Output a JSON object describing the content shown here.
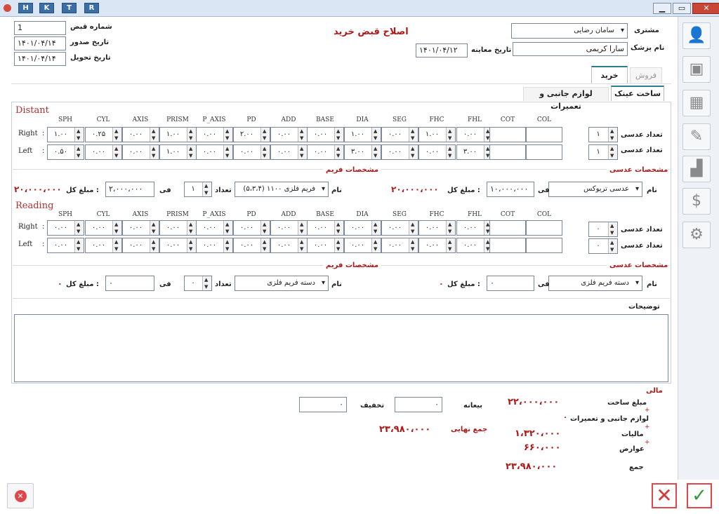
{
  "titlebar": {
    "buttons": [
      "H",
      "K",
      "T",
      "R"
    ]
  },
  "form": {
    "title": "اصلاح قبض خرید"
  },
  "header": {
    "receipt_no_label": "شماره قبض",
    "receipt_no": "1",
    "issue_date_label": "تاریخ صدور",
    "issue_date": "۱۴۰۱/۰۴/۱۴",
    "delivery_date_label": "تاریخ تحویل",
    "delivery_date": "۱۴۰۱/۰۴/۱۴",
    "customer_label": "مشتری",
    "customer": "سامان رضایی",
    "doctor_label": "نام پزشک",
    "doctor": "سارا کریمی",
    "exam_date_label": "تاریخ معاینه",
    "exam_date": "۱۴۰۱/۰۴/۱۲"
  },
  "tabs": {
    "top": [
      "فروش",
      "خرید"
    ],
    "sub": [
      "ساخت عینک",
      "لوازم جانبی و تعمیرات"
    ]
  },
  "columns": [
    "SPH",
    "CYL",
    "AXIS",
    "PRISM",
    "P_AXIS",
    "PD",
    "ADD",
    "BASE",
    "DIA",
    "SEG",
    "FHC",
    "FHL",
    "COT",
    "COL"
  ],
  "distant": {
    "title": "Distant",
    "right_label": "Right",
    "left_label": "Left",
    "right": [
      "۱.۰۰",
      "۰.۲۵",
      "۰.۰۰",
      "۱.۰۰",
      "۰.۰۰",
      "۲.۰۰",
      "۰.۰۰",
      "۰.۰۰",
      "۱.۰۰",
      "۰.۰۰",
      "۱.۰۰",
      "۰.۰۰",
      "",
      ""
    ],
    "left": [
      "۰.۵۰",
      "۰.۰۰",
      "۰.۰۰",
      "۱.۰۰",
      "۰.۰۰",
      "۰.۰۰",
      "۰.۰۰",
      "۰.۰۰",
      "۳.۰۰",
      "۰.۰۰",
      "۰.۰۰",
      "۳.۰۰",
      "",
      ""
    ],
    "lens_count_label": "تعداد عدسی",
    "right_count": "۱",
    "left_count": "۱"
  },
  "reading": {
    "title": "Reading",
    "right_label": "Right",
    "left_label": "Left",
    "right": [
      "۰.۰۰",
      "۰.۰۰",
      "۰.۰۰",
      "۰.۰۰",
      "۰.۰۰",
      "۰.۰۰",
      "۰.۰۰",
      "۰.۰۰",
      "۰.۰۰",
      "۰.۰۰",
      "۰.۰۰",
      "۰.۰۰",
      "",
      ""
    ],
    "left": [
      "۰.۰۰",
      "۰.۰۰",
      "۰.۰۰",
      "۰.۰۰",
      "۰.۰۰",
      "۰.۰۰",
      "۰.۰۰",
      "۰.۰۰",
      "۰.۰۰",
      "۰.۰۰",
      "۰.۰۰",
      "۰.۰۰",
      "",
      ""
    ],
    "lens_count_label": "تعداد عدسی",
    "right_count": "۰",
    "left_count": "۰"
  },
  "lens_spec_label": "مشخصات عدسی",
  "frame_spec_label": "مشخصات فریم",
  "name_label": "نام",
  "price_label": "فی",
  "total_label": "مبلغ کل :",
  "count_label": "تعداد",
  "distant_lens": {
    "name": "عدسی تریوکس",
    "price": "۱۰،۰۰۰،۰۰۰",
    "total": "۲۰،۰۰۰،۰۰۰"
  },
  "distant_frame": {
    "name": "(۵،۳،۴) فریم فلزی ۱۱۰۰",
    "count": "۱",
    "price": "۲،۰۰۰،۰۰۰",
    "total": "۲۰،۰۰۰،۰۰۰"
  },
  "reading_lens": {
    "name": "دسته فریم فلزی",
    "price": "۰",
    "total": "۰"
  },
  "reading_frame": {
    "name": "دسته فریم فلزی",
    "count": "۰",
    "price": "۰",
    "total": "۰"
  },
  "notes_label": "توضیحات",
  "finance": {
    "title": "مالی",
    "build_label": "مبلغ ساخت",
    "build": "۲۲،۰۰۰،۰۰۰",
    "accessories_label": "لوازم جانبی و تعمیرات",
    "accessories": "۰",
    "tax_label": "مالیات",
    "tax": "۱،۳۲۰،۰۰۰",
    "duties_label": "عوارض",
    "duties": "۶۶۰،۰۰۰",
    "sum_label": "جمع",
    "sum": "۲۳،۹۸۰،۰۰۰",
    "deposit_label": "بیعانه",
    "deposit": "۰",
    "discount_label": "تخفیف",
    "discount": "۰",
    "final_label": "جمع نهایی",
    "final": "۲۳،۹۸۰،۰۰۰"
  }
}
